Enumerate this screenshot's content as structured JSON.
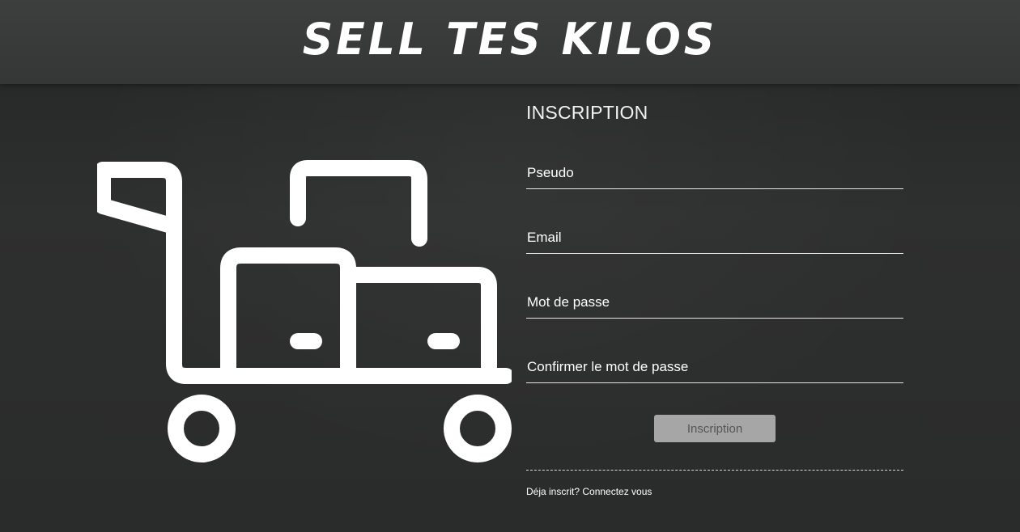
{
  "header": {
    "brand": "SELL TES KILOS"
  },
  "illustration": {
    "icon": "luggage-trolley-icon",
    "color": "#ffffff"
  },
  "form": {
    "title": "INSCRIPTION",
    "fields": [
      {
        "placeholder": "Pseudo",
        "value": ""
      },
      {
        "placeholder": "Email",
        "value": ""
      },
      {
        "placeholder": "Mot de passe",
        "value": ""
      },
      {
        "placeholder": "Confirmer le mot de passe",
        "value": ""
      }
    ],
    "submit_label": "Inscription",
    "login_link": "Déja inscrit? Connectez vous"
  },
  "colors": {
    "background": "#2b2c2c",
    "header": "#3a3b3b",
    "text": "#ffffff",
    "button": "#a6a6a6",
    "button_text": "#555555"
  }
}
